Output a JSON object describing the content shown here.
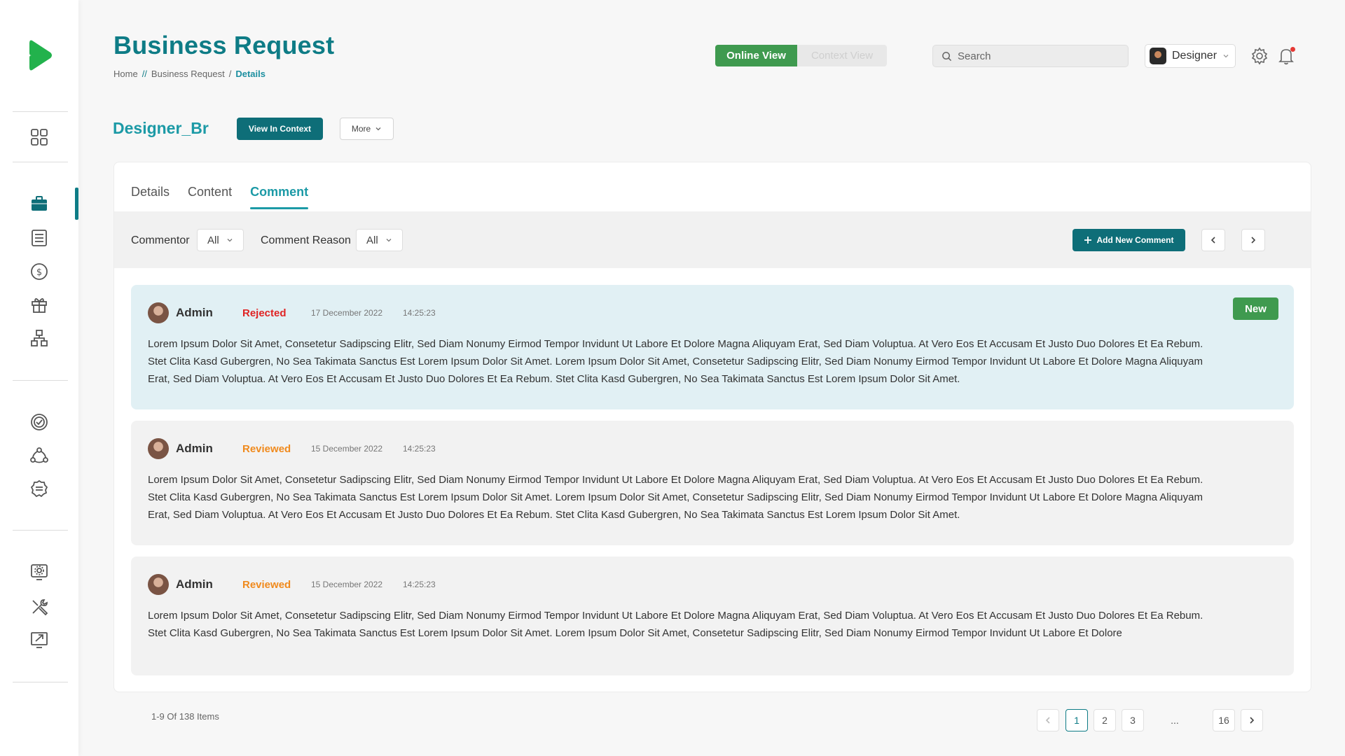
{
  "header": {
    "title": "Business Request",
    "breadcrumb": {
      "home": "Home",
      "sep1": "//",
      "parent": "Business Request",
      "sep2": "/",
      "current": "Details"
    },
    "view_toggle": {
      "online": "Online View",
      "context": "Context View"
    },
    "search": {
      "placeholder": "Search",
      "value": ""
    },
    "user": {
      "name": "Designer"
    }
  },
  "record": {
    "title": "Designer_Br",
    "view_in_context_label": "View In Context",
    "more_label": "More"
  },
  "tabs": [
    {
      "label": "Details"
    },
    {
      "label": "Content"
    },
    {
      "label": "Comment"
    }
  ],
  "filters": {
    "commentor_label": "Commentor",
    "commentor_value": "All",
    "reason_label": "Comment Reason",
    "reason_value": "All",
    "add_label": "Add New Comment"
  },
  "comments": [
    {
      "author": "Admin",
      "status": "Rejected",
      "date": "17 December 2022",
      "time": "14:25:23",
      "badge": "New",
      "text": "Lorem Ipsum Dolor Sit Amet, Consetetur Sadipscing Elitr, Sed Diam Nonumy Eirmod Tempor Invidunt Ut Labore Et Dolore Magna Aliquyam Erat, Sed Diam Voluptua. At Vero Eos Et Accusam Et Justo Duo Dolores Et Ea Rebum. Stet Clita Kasd Gubergren, No Sea Takimata Sanctus Est Lorem Ipsum Dolor Sit Amet. Lorem Ipsum Dolor Sit Amet, Consetetur Sadipscing Elitr, Sed Diam Nonumy Eirmod Tempor Invidunt Ut Labore Et Dolore Magna Aliquyam Erat, Sed Diam Voluptua. At Vero Eos Et Accusam Et Justo Duo Dolores Et Ea Rebum. Stet Clita Kasd Gubergren, No Sea Takimata Sanctus Est Lorem Ipsum Dolor Sit Amet."
    },
    {
      "author": "Admin",
      "status": "Reviewed",
      "date": "15 December 2022",
      "time": "14:25:23",
      "text": "Lorem Ipsum Dolor Sit Amet, Consetetur Sadipscing Elitr, Sed Diam Nonumy Eirmod Tempor Invidunt Ut Labore Et Dolore Magna Aliquyam Erat, Sed Diam Voluptua. At Vero Eos Et Accusam Et Justo Duo Dolores Et Ea Rebum. Stet Clita Kasd Gubergren, No Sea Takimata Sanctus Est Lorem Ipsum Dolor Sit Amet. Lorem Ipsum Dolor Sit Amet, Consetetur Sadipscing Elitr, Sed Diam Nonumy Eirmod Tempor Invidunt Ut Labore Et Dolore Magna Aliquyam Erat, Sed Diam Voluptua. At Vero Eos Et Accusam Et Justo Duo Dolores Et Ea Rebum. Stet Clita Kasd Gubergren, No Sea Takimata Sanctus Est Lorem Ipsum Dolor Sit Amet."
    },
    {
      "author": "Admin",
      "status": "Reviewed",
      "date": "15 December 2022",
      "time": "14:25:23",
      "text": "Lorem Ipsum Dolor Sit Amet, Consetetur Sadipscing Elitr, Sed Diam Nonumy Eirmod Tempor Invidunt Ut Labore Et Dolore Magna Aliquyam Erat, Sed Diam Voluptua. At Vero Eos Et Accusam Et Justo Duo Dolores Et Ea Rebum. Stet Clita Kasd Gubergren, No Sea Takimata Sanctus Est Lorem Ipsum Dolor Sit Amet. Lorem Ipsum Dolor Sit Amet, Consetetur Sadipscing Elitr, Sed Diam Nonumy Eirmod Tempor Invidunt Ut Labore Et Dolore"
    }
  ],
  "pagination": {
    "summary": "1-9 Of 138 Items",
    "pages": [
      "1",
      "2",
      "3",
      "...",
      "16"
    ],
    "current": "1"
  },
  "colors": {
    "primary": "#0e7c86",
    "accent": "#1c9aa6",
    "success": "#3f9a4f",
    "rejected": "#e02424",
    "reviewed": "#f08a1d"
  }
}
